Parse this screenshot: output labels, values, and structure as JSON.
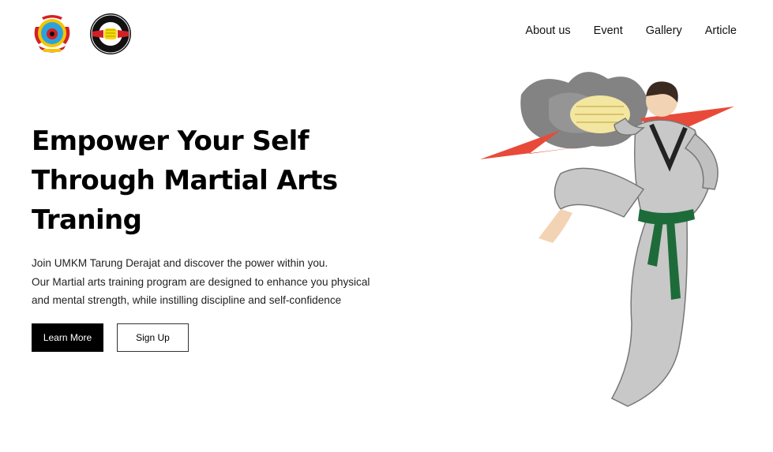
{
  "header": {
    "logos": [
      {
        "name": "organization-emblem",
        "colors": {
          "red": "#d32027",
          "gold": "#f5c400",
          "blue": "#2aa3dd"
        }
      },
      {
        "name": "tarung-derajat-emblem",
        "colors": {
          "black": "#111111",
          "red": "#d32027",
          "yellow": "#f5d90a"
        }
      }
    ],
    "nav": [
      {
        "label": "About us"
      },
      {
        "label": "Event"
      },
      {
        "label": "Gallery"
      },
      {
        "label": "Article"
      }
    ]
  },
  "hero": {
    "title_lines": [
      "Empower Your Self",
      "Through Martial Arts",
      "Traning"
    ],
    "description_lines": [
      "Join UMKM Tarung Derajat and discover the power within you.",
      "Our Martial arts training program are designed to enhance you physical",
      "and mental strength, while instilling discipline and self-confidence"
    ],
    "buttons": {
      "learn_more": "Learn More",
      "sign_up": "Sign Up"
    },
    "illustration": {
      "name": "martial-artist-kick-illustration",
      "colors": {
        "uniform": "#c8c8c8",
        "belt": "#1e6b3a",
        "burst": "#e84a3a",
        "fist": "#f3e6a0",
        "smoke": "#6d6d6d"
      }
    }
  }
}
